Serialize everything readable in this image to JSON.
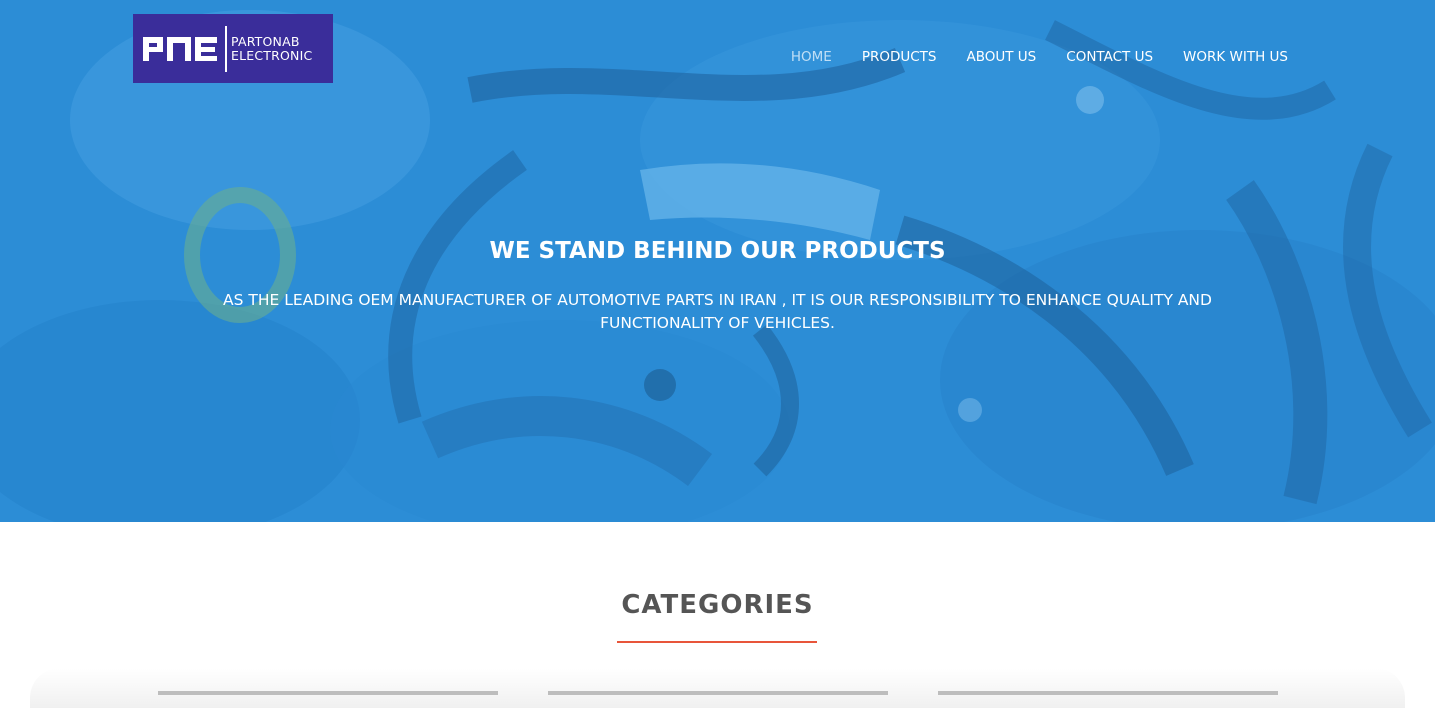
{
  "brand": {
    "mark": "PNE",
    "name_line1": "PARTONAB",
    "name_line2": "ELECTRONIC",
    "color": "#3a2d9a"
  },
  "nav": {
    "items": [
      {
        "label": "HOME",
        "active": true
      },
      {
        "label": "PRODUCTS",
        "active": false
      },
      {
        "label": "ABOUT US",
        "active": false
      },
      {
        "label": "CONTACT US",
        "active": false
      },
      {
        "label": "WORK WITH US",
        "active": false
      }
    ]
  },
  "hero": {
    "title": "WE STAND BEHIND OUR PRODUCTS",
    "subtitle": "AS THE LEADING OEM MANUFACTURER OF AUTOMOTIVE PARTS IN IRAN , IT IS OUR RESPONSIBILITY TO ENHANCE QUALITY AND FUNCTIONALITY OF VEHICLES.",
    "overlay_color": "#2f8fd8"
  },
  "categories": {
    "title": "CATEGORIES",
    "accent_color": "#e8553a"
  }
}
